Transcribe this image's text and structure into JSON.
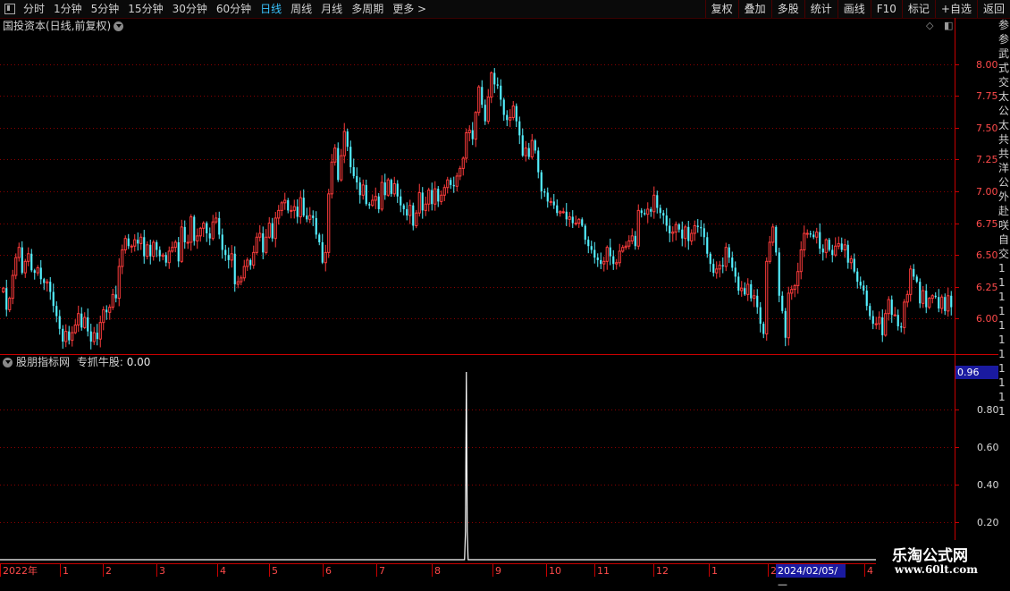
{
  "toolbar": {
    "tabs": [
      {
        "label": "分时"
      },
      {
        "label": "1分钟"
      },
      {
        "label": "5分钟"
      },
      {
        "label": "15分钟"
      },
      {
        "label": "30分钟"
      },
      {
        "label": "60分钟"
      },
      {
        "label": "日线",
        "active": true
      },
      {
        "label": "周线"
      },
      {
        "label": "月线"
      },
      {
        "label": "多周期"
      },
      {
        "label": "更多 >"
      }
    ],
    "buttons": [
      "复权",
      "叠加",
      "多股",
      "统计",
      "画线",
      "F10",
      "标记",
      "+自选",
      "返回"
    ]
  },
  "main_chart": {
    "title": "国投资本(日线,前复权)",
    "y_ticks": [
      "8.00",
      "7.75",
      "7.50",
      "7.25",
      "7.00",
      "6.75",
      "6.50",
      "6.25",
      "6.00"
    ]
  },
  "indicator": {
    "title": "股朋指标网",
    "series_label": "专抓牛股:",
    "series_value": "0.00",
    "readout": "0.96",
    "y_ticks": [
      "0.80",
      "0.60",
      "0.40",
      "0.20"
    ]
  },
  "right_strip_chars": [
    "参",
    "参",
    "武",
    "式",
    "交",
    "太",
    "公",
    "太",
    "共",
    "共",
    "洋",
    "公",
    "外",
    "赴",
    "咲",
    "自",
    "交",
    "1",
    "1",
    "1",
    "1",
    "1",
    "1",
    "1",
    "1",
    "1",
    "1",
    "1"
  ],
  "x_axis": {
    "labels": [
      "2022年",
      "1",
      "2",
      "3",
      "4",
      "5",
      "6",
      "7",
      "8",
      "9",
      "10",
      "11",
      "12",
      "1",
      "2",
      "4"
    ],
    "cursor_date": "2024/02/05/—"
  },
  "watermark": {
    "line1": "乐淘公式网",
    "line2": "www.60lt.com"
  },
  "colors": {
    "up": "#ff3c3c",
    "down": "#54f0ff",
    "axis": "#c80000",
    "grid": "#8b0000",
    "signal": "#ffffff"
  },
  "chart_data": {
    "type": "candlestick",
    "series_name": "国投资本(日线,前复权)",
    "ylim": [
      5.75,
      8.25
    ],
    "close": [
      6.24,
      6.07,
      6.16,
      6.34,
      6.48,
      6.56,
      6.36,
      6.45,
      6.51,
      6.38,
      6.36,
      6.4,
      6.31,
      6.28,
      6.29,
      6.21,
      6.1,
      6.02,
      5.92,
      5.82,
      5.9,
      5.83,
      5.89,
      5.95,
      6.04,
      5.93,
      6.01,
      5.9,
      5.82,
      5.89,
      5.84,
      5.97,
      6.07,
      6.05,
      6.09,
      6.19,
      6.16,
      6.41,
      6.54,
      6.63,
      6.57,
      6.57,
      6.62,
      6.59,
      6.64,
      6.49,
      6.58,
      6.49,
      6.6,
      6.54,
      6.49,
      6.5,
      6.44,
      6.53,
      6.56,
      6.6,
      6.45,
      6.72,
      6.6,
      6.6,
      6.8,
      6.61,
      6.65,
      6.71,
      6.75,
      6.67,
      6.63,
      6.76,
      6.79,
      6.66,
      6.54,
      6.5,
      6.46,
      6.51,
      6.27,
      6.29,
      6.32,
      6.41,
      6.46,
      6.42,
      6.52,
      6.64,
      6.67,
      6.52,
      6.64,
      6.75,
      6.63,
      6.79,
      6.85,
      6.91,
      6.93,
      6.85,
      6.85,
      6.88,
      6.8,
      6.95,
      6.81,
      6.78,
      6.81,
      6.79,
      6.66,
      6.6,
      6.44,
      6.52,
      6.98,
      7.23,
      7.34,
      7.09,
      7.28,
      7.47,
      7.35,
      7.19,
      7.12,
      7.07,
      6.97,
      7.05,
      6.9,
      6.89,
      6.93,
      6.96,
      6.86,
      7.07,
      6.97,
      7.09,
      6.98,
      7.06,
      6.96,
      6.89,
      6.86,
      6.81,
      6.89,
      6.73,
      6.83,
      6.99,
      6.85,
      6.9,
      7.01,
      6.9,
      7.02,
      6.92,
      6.97,
      7.03,
      7.09,
      7.05,
      7.04,
      7.12,
      7.18,
      7.26,
      7.46,
      7.48,
      7.41,
      7.62,
      7.82,
      7.68,
      7.55,
      7.74,
      7.93,
      7.84,
      7.83,
      7.72,
      7.6,
      7.56,
      7.58,
      7.67,
      7.55,
      7.44,
      7.28,
      7.34,
      7.27,
      7.4,
      7.32,
      7.15,
      7.0,
      6.99,
      6.92,
      6.92,
      6.89,
      6.83,
      6.84,
      6.84,
      6.78,
      6.8,
      6.75,
      6.75,
      6.78,
      6.73,
      6.62,
      6.57,
      6.54,
      6.48,
      6.46,
      6.43,
      6.45,
      6.56,
      6.49,
      6.43,
      6.44,
      6.53,
      6.56,
      6.57,
      6.61,
      6.65,
      6.57,
      6.85,
      6.83,
      6.82,
      6.86,
      6.84,
      6.97,
      6.87,
      6.83,
      6.81,
      6.73,
      6.67,
      6.68,
      6.74,
      6.7,
      6.63,
      6.72,
      6.61,
      6.67,
      6.73,
      6.72,
      6.71,
      6.64,
      6.51,
      6.43,
      6.36,
      6.39,
      6.42,
      6.41,
      6.56,
      6.48,
      6.4,
      6.33,
      6.22,
      6.24,
      6.19,
      6.27,
      6.16,
      6.18,
      6.09,
      5.96,
      5.88,
      6.45,
      6.6,
      6.72,
      6.52,
      6.18,
      6.06,
      5.85,
      6.2,
      6.23,
      6.26,
      6.37,
      6.54,
      6.67,
      6.67,
      6.66,
      6.64,
      6.68,
      6.55,
      6.52,
      6.62,
      6.54,
      6.5,
      6.57,
      6.59,
      6.54,
      6.58,
      6.44,
      6.47,
      6.37,
      6.29,
      6.26,
      6.22,
      6.1,
      6.02,
      5.96,
      5.96,
      6.01,
      5.87,
      6.04,
      6.15,
      6.03,
      6.03,
      5.94,
      5.93,
      6.13,
      6.19,
      6.39,
      6.33,
      6.29,
      6.12,
      6.22,
      6.09,
      6.16,
      6.18,
      6.17,
      6.08,
      6.17,
      6.06,
      6.18,
      6.09
    ],
    "signal": {
      "index": 148,
      "value": 1.0
    },
    "indicator_ylim": [
      0,
      1.0
    ]
  }
}
